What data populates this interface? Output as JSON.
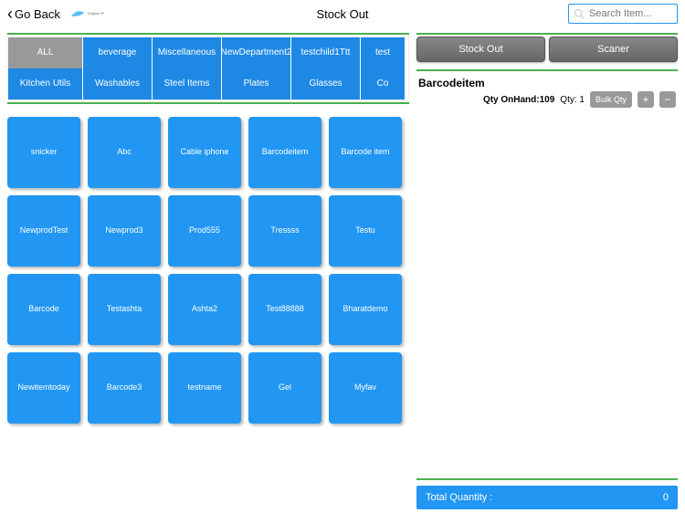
{
  "header": {
    "back_label": "Go Back",
    "title": "Stock Out",
    "search_placeholder": "Search Item..."
  },
  "categories": {
    "row1": [
      {
        "label": "ALL",
        "active": true
      },
      {
        "label": "beverage"
      },
      {
        "label": "Miscellaneous"
      },
      {
        "label": "NewDepartment2"
      },
      {
        "label": "testchild1Ttt"
      },
      {
        "label": "test"
      }
    ],
    "row2": [
      {
        "label": "Kitchen Utils"
      },
      {
        "label": "Washables"
      },
      {
        "label": "Steel Items"
      },
      {
        "label": "Plates"
      },
      {
        "label": "Glasses"
      },
      {
        "label": "Co"
      }
    ]
  },
  "items": [
    "snicker",
    "Abc",
    "Cable iphone",
    "Barcodeitem",
    "Barcode item",
    "NewprodTest",
    "Newprod3",
    "Prod555",
    "Tressss",
    "Testu",
    "Barcode",
    "Testashta",
    "Ashta2",
    "Test88888",
    "Bharatdemo",
    "Newitemtoday",
    "Barcode3",
    "testname",
    "Gel",
    "Myfav"
  ],
  "actions": {
    "stock_out": "Stock Out",
    "scanner": "Scaner"
  },
  "line_items": [
    {
      "name": "Barcodeitem",
      "onhand_label": "Qty OnHand:",
      "onhand_value": "109",
      "qty_label": "Qty:",
      "qty_value": "1",
      "bulk_label": "Bulk Qty"
    }
  ],
  "total": {
    "label": "Total Quantity :",
    "value": "0"
  }
}
